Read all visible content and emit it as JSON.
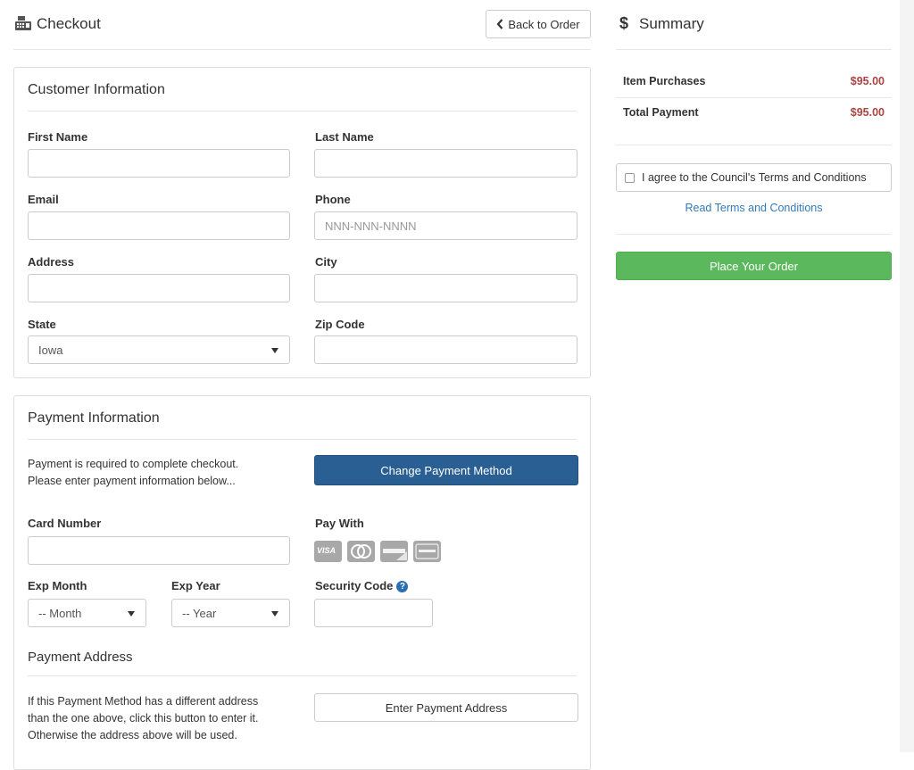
{
  "header": {
    "title": "Checkout",
    "back_label": "Back to Order"
  },
  "customer": {
    "title": "Customer Information",
    "first_name": {
      "label": "First Name",
      "value": "",
      "placeholder": ""
    },
    "last_name": {
      "label": "Last Name",
      "value": "",
      "placeholder": ""
    },
    "email": {
      "label": "Email",
      "value": "",
      "placeholder": ""
    },
    "phone": {
      "label": "Phone",
      "value": "",
      "placeholder": "NNN-NNN-NNNN"
    },
    "address": {
      "label": "Address",
      "value": "",
      "placeholder": ""
    },
    "city": {
      "label": "City",
      "value": "",
      "placeholder": ""
    },
    "state": {
      "label": "State",
      "value": "Iowa"
    },
    "zip": {
      "label": "Zip Code",
      "value": "",
      "placeholder": ""
    }
  },
  "payment": {
    "title": "Payment Information",
    "note_line1": "Payment is required to complete checkout.",
    "note_line2": "Please enter payment information below...",
    "change_label": "Change Payment Method",
    "card_number_label": "Card Number",
    "pay_with_label": "Pay With",
    "card_icons": [
      "visa-icon",
      "mastercard-icon",
      "discover-icon",
      "amex-icon"
    ],
    "visa_text": "VISA",
    "exp_month_label": "Exp Month",
    "exp_month_value": "-- Month",
    "exp_year_label": "Exp Year",
    "exp_year_value": "-- Year",
    "security_label": "Security Code",
    "address_title": "Payment Address",
    "address_note_line1": "If this Payment Method has a different address",
    "address_note_line2": "than the one above, click this button to enter it.",
    "address_note_line3": "Otherwise the address above will be used.",
    "enter_address_label": "Enter Payment Address"
  },
  "summary": {
    "title": "Summary",
    "rows": [
      {
        "label": "Item Purchases",
        "value": "$95.00"
      },
      {
        "label": "Total Payment",
        "value": "$95.00"
      }
    ],
    "terms_label": "I agree to the Council's Terms and Conditions",
    "terms_checked": false,
    "read_terms_label": "Read Terms and Conditions",
    "place_order_label": "Place Your Order"
  },
  "colors": {
    "primary_blue": "#2a5f93",
    "success_green": "#5cb85c",
    "price_red": "#a94442",
    "link_blue": "#337ab7"
  }
}
